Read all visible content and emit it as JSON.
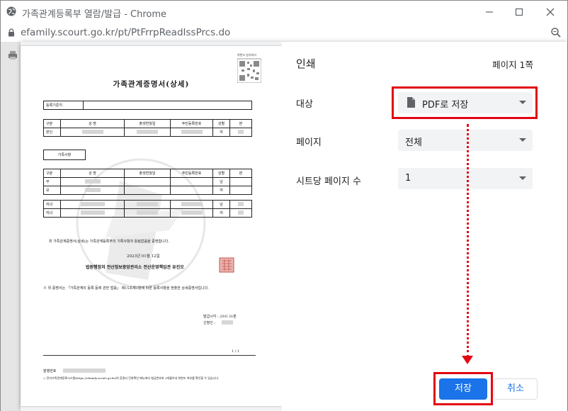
{
  "window": {
    "title": "가족관계등록부 열람/발급 - Chrome",
    "url": "efamily.scourt.go.kr/pt/PtFrrpReadIssPrcs.do"
  },
  "print": {
    "title": "인쇄",
    "page_count": "페이지 1쪽",
    "destination_label": "대상",
    "destination_value": "PDF로 저장",
    "pages_label": "페이지",
    "pages_value": "전체",
    "pages_per_sheet_label": "시트당 페이지 수",
    "pages_per_sheet_value": "1",
    "save_label": "저장",
    "cancel_label": "취소"
  },
  "document": {
    "title": "가족관계증명서(상세)",
    "registry_label": "등록기준지",
    "family_label": "가족사항",
    "headers": [
      "구분",
      "성 명",
      "출생연월일",
      "주민등록번호",
      "성별",
      "본"
    ],
    "self_row_label": "본인",
    "self_gender": "여",
    "family_rows": [
      {
        "label": "부",
        "gender": "남"
      },
      {
        "label": "모",
        "gender": "여"
      },
      {
        "label": "자녀",
        "gender": "남"
      },
      {
        "label": "자녀",
        "gender": "여"
      }
    ],
    "certify_text": "위 가족관계증명서(상세)는 가족관계등록부의 기록사항과 틀림없음을 증명합니다.",
    "date_text": "2023년 01월 12일",
    "issuer_text": "법원행정처 전산정보중앙관리소 전산운영책임관 유진오",
    "notice_text": "※ 위 증명서는 「가족관계의 등록 등에 관한 법률」 제15조제3항에 따른 등록사항을 현출한 상세증명서입니다.",
    "issue_time": "발급시각 : 20시 31분",
    "applicant": "신청인 :",
    "page_num": "1 / 1",
    "footer_label": "발행번호",
    "footer_text": "○ 전자가족관계등록시스템(https://efamily.scourt.go.kr)의 증명서 진위확인 메뉴에서 발급번호와 3개월이내 위변조 여부를 확인할 수 있습니다.",
    "qr_label": "위변조 방지처리"
  },
  "colors": {
    "accent": "#1a73e8",
    "highlight": "#e30613"
  }
}
